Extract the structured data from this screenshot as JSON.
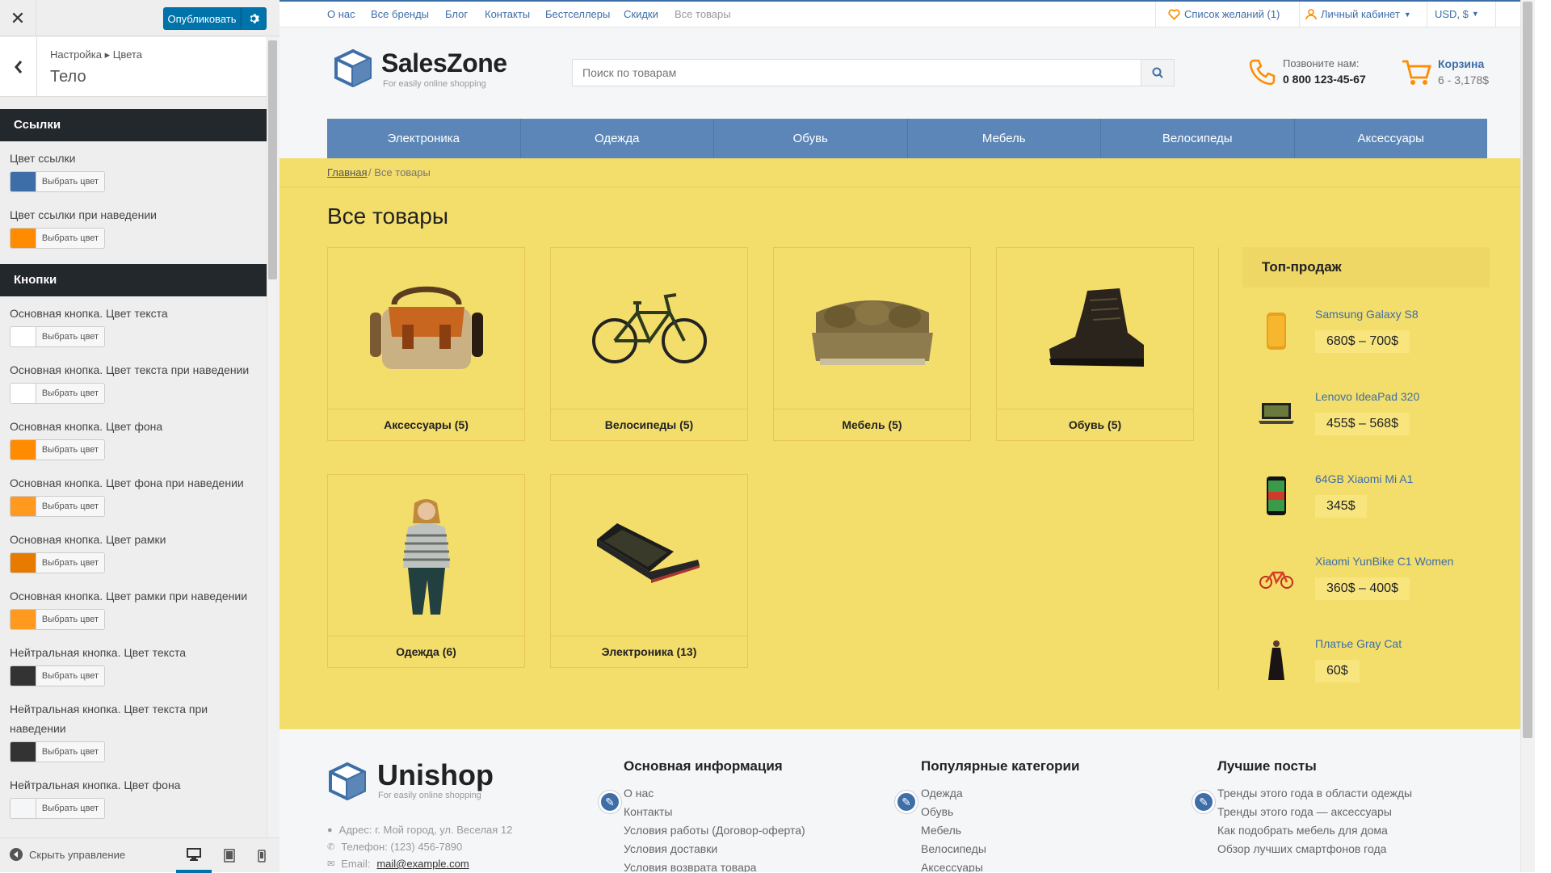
{
  "customizer": {
    "close_icon": "close-icon",
    "publish_label": "Опубликовать",
    "breadcrumb": "Настройка ▸ Цвета",
    "section_title": "Тело",
    "pick_label": "Выбрать цвет",
    "sections": [
      {
        "title": "Ссылки"
      },
      {
        "title": "Кнопки"
      }
    ],
    "controls": [
      {
        "label": "Цвет ссылки",
        "color": "#3e6ea8"
      },
      {
        "label": "Цвет ссылки при наведении",
        "color": "#ff8c00"
      },
      {
        "label": "Основная кнопка. Цвет текста",
        "color": "#ffffff"
      },
      {
        "label": "Основная кнопка. Цвет текста при наведении",
        "color": "#ffffff"
      },
      {
        "label": "Основная кнопка. Цвет фона",
        "color": "#ff8c00"
      },
      {
        "label": "Основная кнопка. Цвет фона при наведении",
        "color": "#ff9a1f"
      },
      {
        "label": "Основная кнопка. Цвет рамки",
        "color": "#e77b00"
      },
      {
        "label": "Основная кнопка. Цвет рамки при наведении",
        "color": "#ff9a1f"
      },
      {
        "label": "Нейтральная кнопка. Цвет текста",
        "color": "#333333"
      },
      {
        "label": "Нейтральная кнопка. Цвет текста при наведении",
        "color": "#333333"
      },
      {
        "label": "Нейтральная кнопка. Цвет фона",
        "color": "#f4f6f8"
      }
    ],
    "hide_label": "Скрыть управление"
  },
  "site": {
    "top_links": [
      "О нас",
      "Все бренды",
      "Блог",
      "Контакты",
      "Бестселлеры",
      "Скидки",
      "Все товары"
    ],
    "wishlist": "Список желаний (1)",
    "account": "Личный кабинет",
    "currency": "USD, $",
    "logo_name": "SalesZone",
    "logo_tagline": "For easily online shopping",
    "search_placeholder": "Поиск по товарам",
    "call_label": "Позвоните нам:",
    "phone": "0 800 123-45-67",
    "cart_label": "Корзина",
    "cart_info": "6 - 3,178$",
    "nav": [
      "Электроника",
      "Одежда",
      "Обувь",
      "Мебель",
      "Велосипеды",
      "Аксессуары"
    ],
    "breadcrumb_home": "Главная",
    "breadcrumb_sep": "/",
    "breadcrumb_current": "Все товары",
    "page_title": "Все товары",
    "categories": [
      {
        "name": "Аксессуары (5)",
        "icon": "bag-icon"
      },
      {
        "name": "Велосипеды (5)",
        "icon": "bicycle-icon"
      },
      {
        "name": "Мебель (5)",
        "icon": "sofa-icon"
      },
      {
        "name": "Обувь (5)",
        "icon": "boot-icon"
      },
      {
        "name": "Одежда (6)",
        "icon": "woman-icon"
      },
      {
        "name": "Электроника (13)",
        "icon": "laptop-icon"
      }
    ],
    "top_sales_title": "Топ-продаж",
    "top_sales": [
      {
        "name": "Samsung Galaxy S8",
        "price": "680$ – 700$"
      },
      {
        "name": "Lenovo IdeaPad 320",
        "price": "455$ – 568$"
      },
      {
        "name": "64GB Xiaomi Mi A1",
        "price": "345$"
      },
      {
        "name": "Xiaomi YunBike C1 Women",
        "price": "360$ – 400$"
      },
      {
        "name": "Платье Gray Cat",
        "price": "60$"
      }
    ],
    "footer": {
      "logo_name": "Unishop",
      "logo_tagline": "For easily online shopping",
      "address": "Адрес:  г. Мой город, ул. Веселая 12",
      "phone": "Телефон:  (123) 456-7890",
      "email_label": "Email:",
      "email": "mail@example.com",
      "col1_title": "Основная информация",
      "col1_links": [
        "О нас",
        "Контакты",
        "Условия работы (Договор-оферта)",
        "Условия доставки",
        "Условия возврата товара"
      ],
      "col2_title": "Популярные категории",
      "col2_links": [
        "Одежда",
        "Обувь",
        "Мебель",
        "Велосипеды",
        "Аксессуары"
      ],
      "col3_title": "Лучшие посты",
      "col3_links": [
        "Тренды этого года в области одежды",
        "Тренды этого года — аксессуары",
        "Как подобрать мебель для дома",
        "Обзор лучших смартфонов года"
      ]
    }
  },
  "colors": {
    "accent": "#3e6ea8",
    "publish": "#0073aa",
    "page_bg": "#f3dd6b",
    "dark_section": "#23282d",
    "orange": "#ff8c00"
  }
}
